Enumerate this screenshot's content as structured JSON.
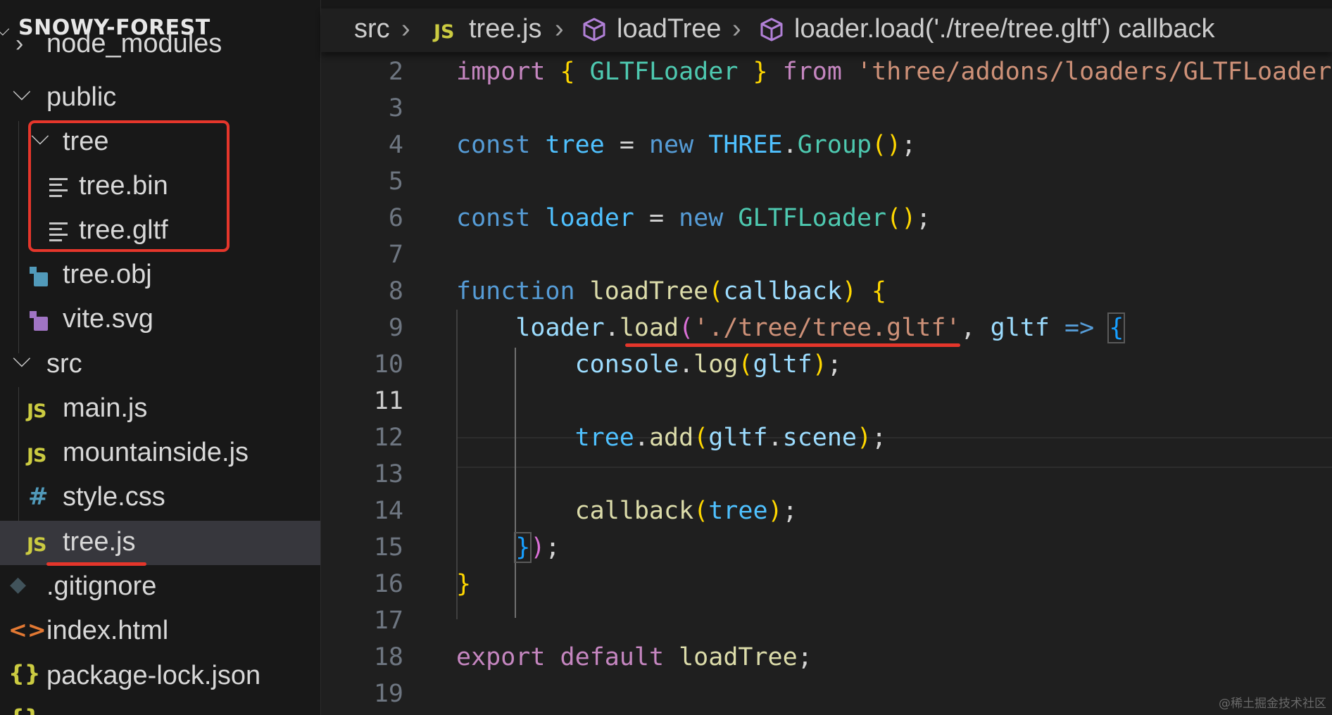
{
  "explorer": {
    "title": "SNOWY-FOREST",
    "items": [
      {
        "label": "node_modules",
        "type": "folder",
        "expanded": false
      },
      {
        "label": "public",
        "type": "folder",
        "expanded": true
      },
      {
        "label": "tree",
        "type": "folder",
        "expanded": true
      },
      {
        "label": "tree.bin",
        "type": "file",
        "icon": "lines-file-icon"
      },
      {
        "label": "tree.gltf",
        "type": "file",
        "icon": "lines-file-icon"
      },
      {
        "label": "tree.obj",
        "type": "file",
        "icon": "image-file-icon-blue"
      },
      {
        "label": "vite.svg",
        "type": "file",
        "icon": "image-file-icon-purple"
      },
      {
        "label": "src",
        "type": "folder",
        "expanded": true
      },
      {
        "label": "main.js",
        "type": "file",
        "icon": "JS"
      },
      {
        "label": "mountainside.js",
        "type": "file",
        "icon": "JS"
      },
      {
        "label": "style.css",
        "type": "file",
        "icon": "#"
      },
      {
        "label": "tree.js",
        "type": "file",
        "icon": "JS",
        "active": true
      },
      {
        "label": ".gitignore",
        "type": "file",
        "icon": "git-icon"
      },
      {
        "label": "index.html",
        "type": "file",
        "icon": "<>"
      },
      {
        "label": "package-lock.json",
        "type": "file",
        "icon": "{}"
      }
    ]
  },
  "icons": {
    "js": "JS",
    "css": "#",
    "html": "<>",
    "json": "{}",
    "chevron_down": "⌵",
    "chevron_right": "›"
  },
  "breadcrumb": {
    "folder": "src",
    "file": "tree.js",
    "symbol1": "loadTree",
    "symbol2": "loader.load('./tree/tree.gltf') callback"
  },
  "editor": {
    "current_line": 11,
    "lines": [
      {
        "n": "2"
      },
      {
        "n": "3"
      },
      {
        "n": "4"
      },
      {
        "n": "5"
      },
      {
        "n": "6"
      },
      {
        "n": "7"
      },
      {
        "n": "8"
      },
      {
        "n": "9"
      },
      {
        "n": "10"
      },
      {
        "n": "11"
      },
      {
        "n": "12"
      },
      {
        "n": "13"
      },
      {
        "n": "14"
      },
      {
        "n": "15"
      },
      {
        "n": "16"
      },
      {
        "n": "17"
      },
      {
        "n": "18"
      },
      {
        "n": "19"
      }
    ],
    "tokens": {
      "import": "import",
      "gltfloader_class": "GLTFLoader",
      "from": "from",
      "module_path": "'three/addons/loaders/GLTFLoader.",
      "const": "const",
      "tree_var": "tree",
      "new": "new",
      "three": "THREE",
      "group": "Group",
      "loader_var": "loader",
      "function": "function",
      "load_tree": "loadTree",
      "callback": "callback",
      "load": "load",
      "gltf_path": "'./tree/tree.gltf'",
      "gltf": "gltf",
      "arrow": "=>",
      "console": "console",
      "log": "log",
      "add": "add",
      "scene": "scene",
      "export": "export",
      "default": "default"
    }
  },
  "annotations": {
    "color": "#e5362b"
  },
  "watermark": "@稀土掘金技术社区"
}
